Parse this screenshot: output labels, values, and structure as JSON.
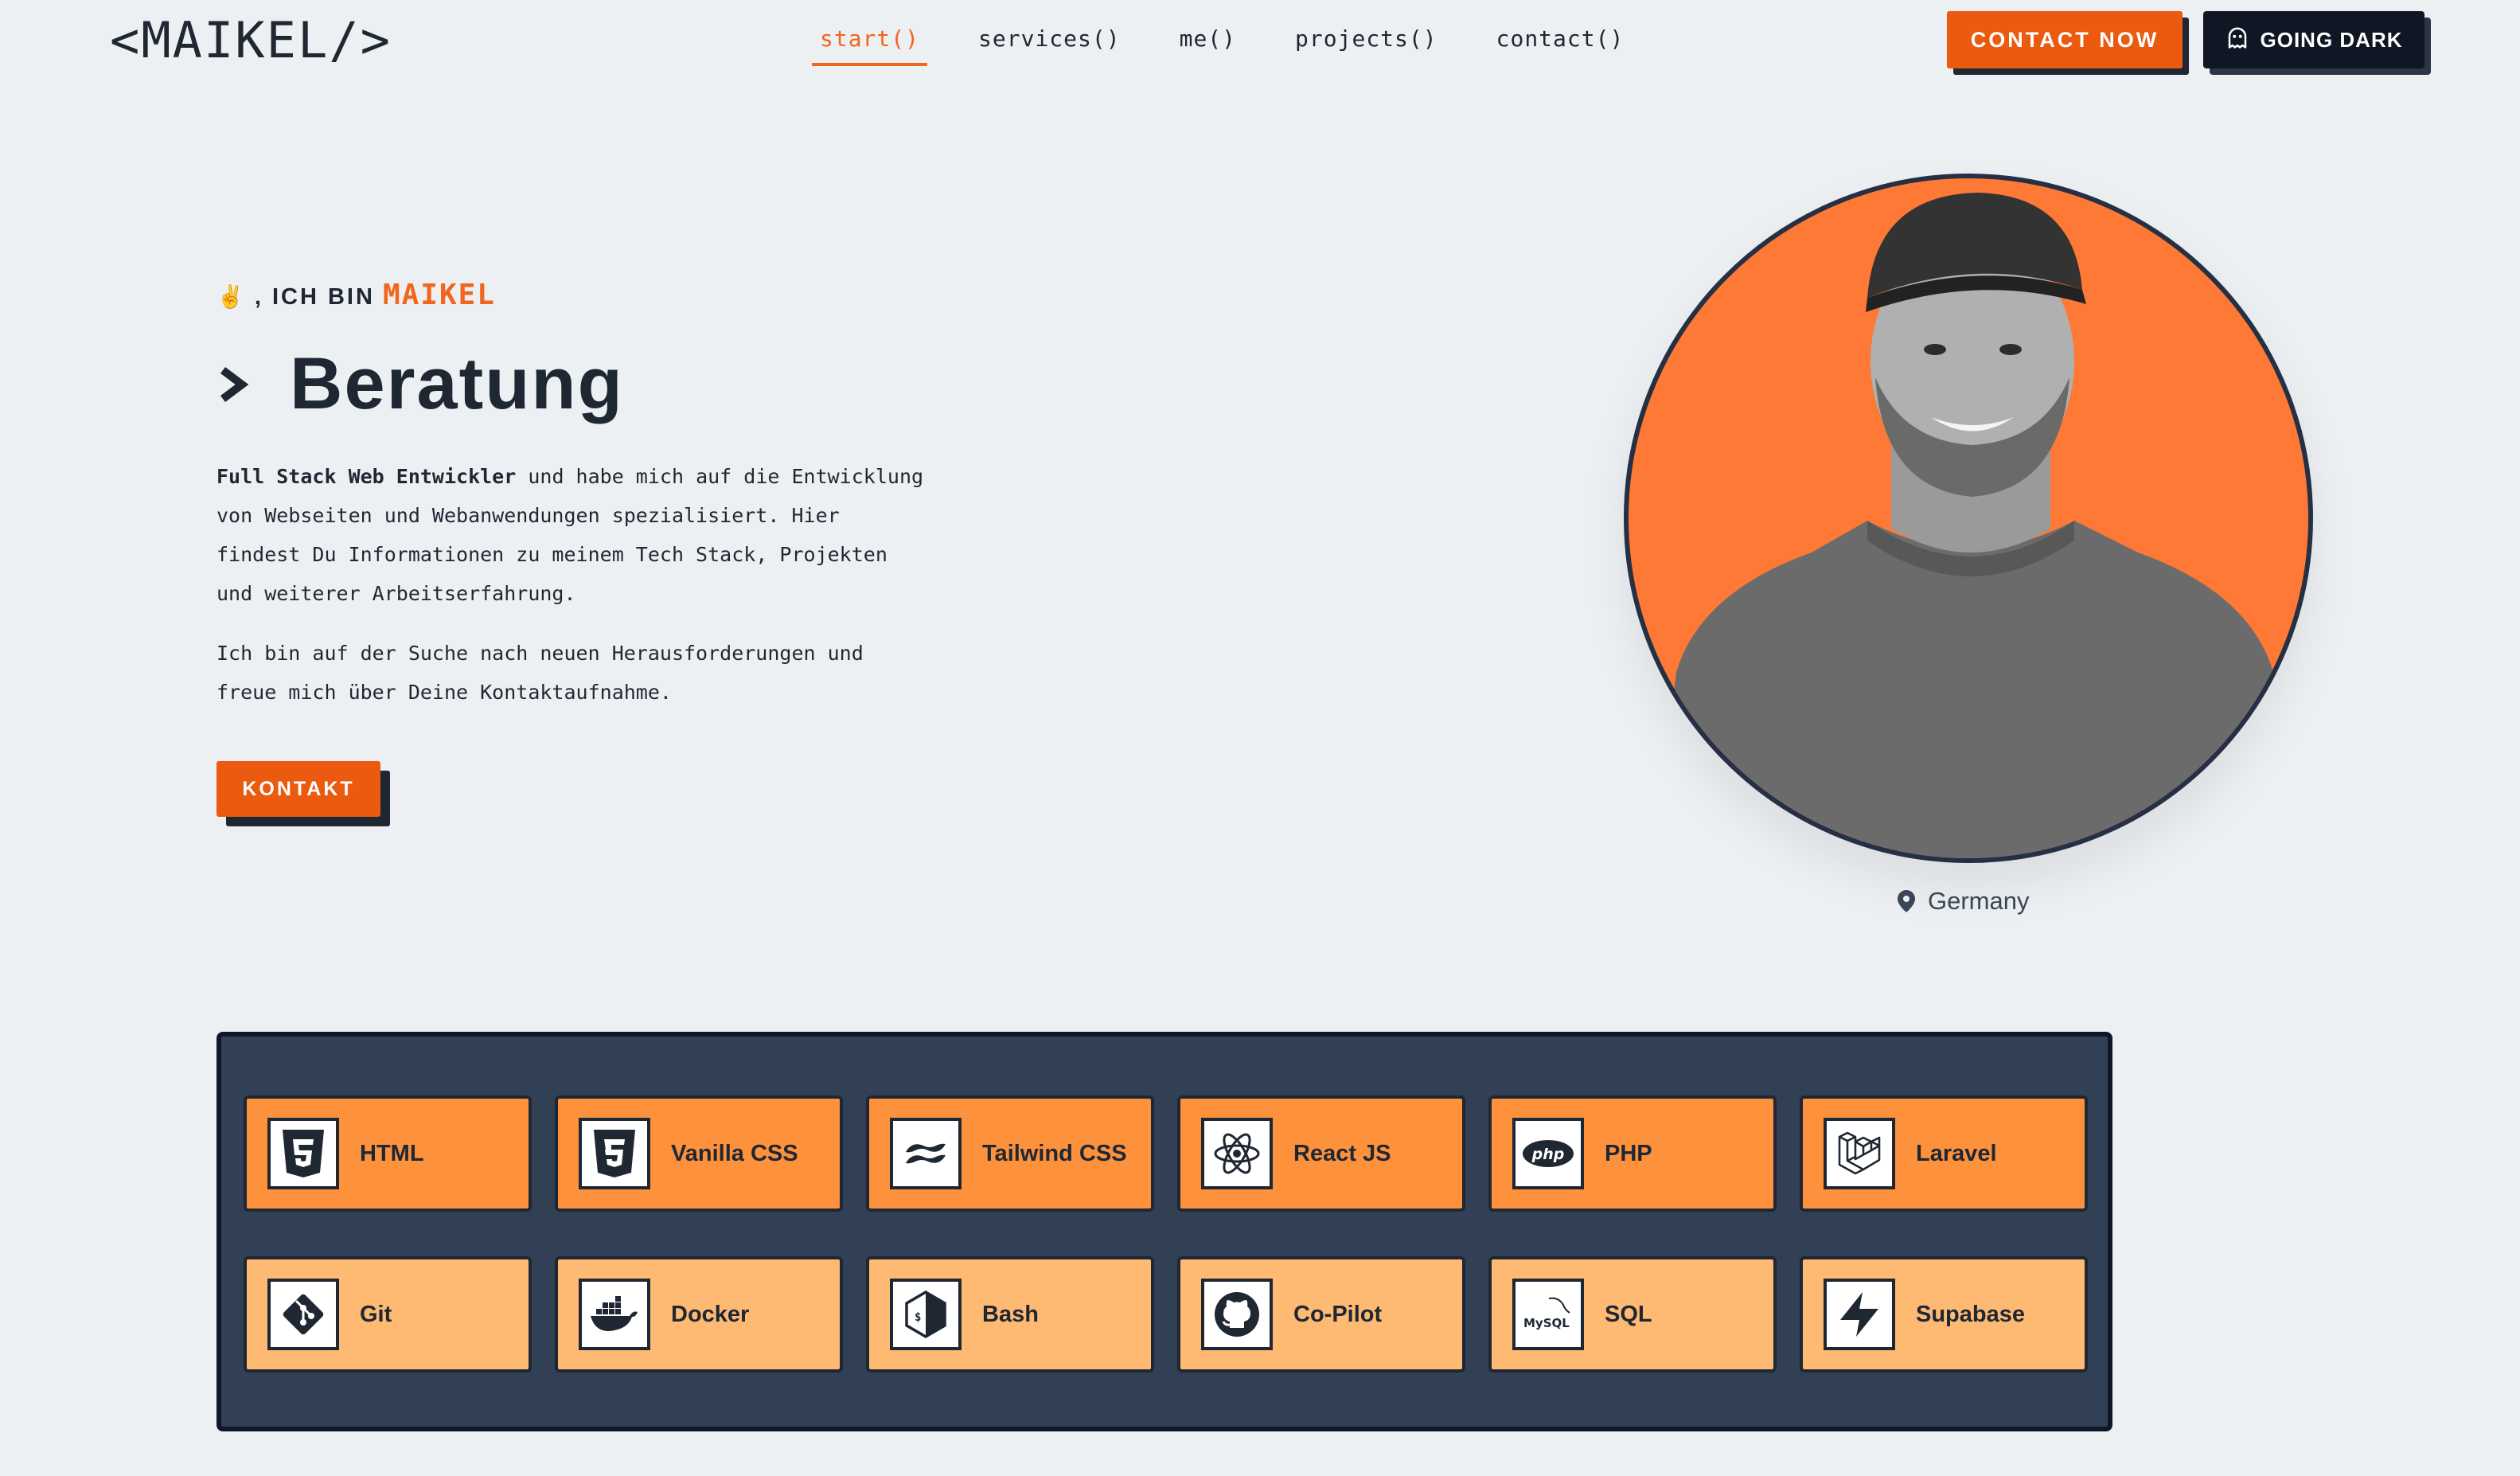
{
  "header": {
    "logo": "<MAIKEL/>",
    "nav": [
      {
        "label": "start()",
        "active": true
      },
      {
        "label": "services()"
      },
      {
        "label": "me()"
      },
      {
        "label": "projects()"
      },
      {
        "label": "contact()"
      }
    ],
    "contact_now": "CONTACT NOW",
    "going_dark": "GOING DARK"
  },
  "hero": {
    "greeting_hand": "✌",
    "greeting_prefix": ", ICH BIN",
    "greeting_name": "MAIKEL",
    "role": "Beratung",
    "intro_bold": "Full Stack Web Entwickler",
    "intro_rest": " und habe mich auf die Entwicklung von Webseiten und Webanwendungen spezialisiert. Hier findest Du Informationen zu meinem Tech Stack, Projekten und weiterer Arbeitserfahrung.",
    "intro_second": "Ich bin auf der Suche nach neuen Herausforderungen und freue mich über Deine Kontaktaufnahme.",
    "cta": "KONTAKT",
    "location": "Germany"
  },
  "skills": [
    {
      "label": "HTML",
      "icon": "html5-icon"
    },
    {
      "label": "Vanilla CSS",
      "icon": "css3-icon"
    },
    {
      "label": "Tailwind CSS",
      "icon": "tailwind-icon"
    },
    {
      "label": "React JS",
      "icon": "react-icon"
    },
    {
      "label": "PHP",
      "icon": "php-icon"
    },
    {
      "label": "Laravel",
      "icon": "laravel-icon"
    },
    {
      "label": "Git",
      "icon": "git-icon"
    },
    {
      "label": "Docker",
      "icon": "docker-icon"
    },
    {
      "label": "Bash",
      "icon": "bash-icon"
    },
    {
      "label": "Co-Pilot",
      "icon": "github-icon"
    },
    {
      "label": "SQL",
      "icon": "mysql-icon"
    },
    {
      "label": "Supabase",
      "icon": "supabase-icon"
    }
  ],
  "colors": {
    "accent": "#ea5b10",
    "dark": "#1f2733",
    "panel": "#314055",
    "skill_row1": "#fd913c",
    "skill_row2": "#feba72",
    "portrait_bg": "#fd7935"
  }
}
